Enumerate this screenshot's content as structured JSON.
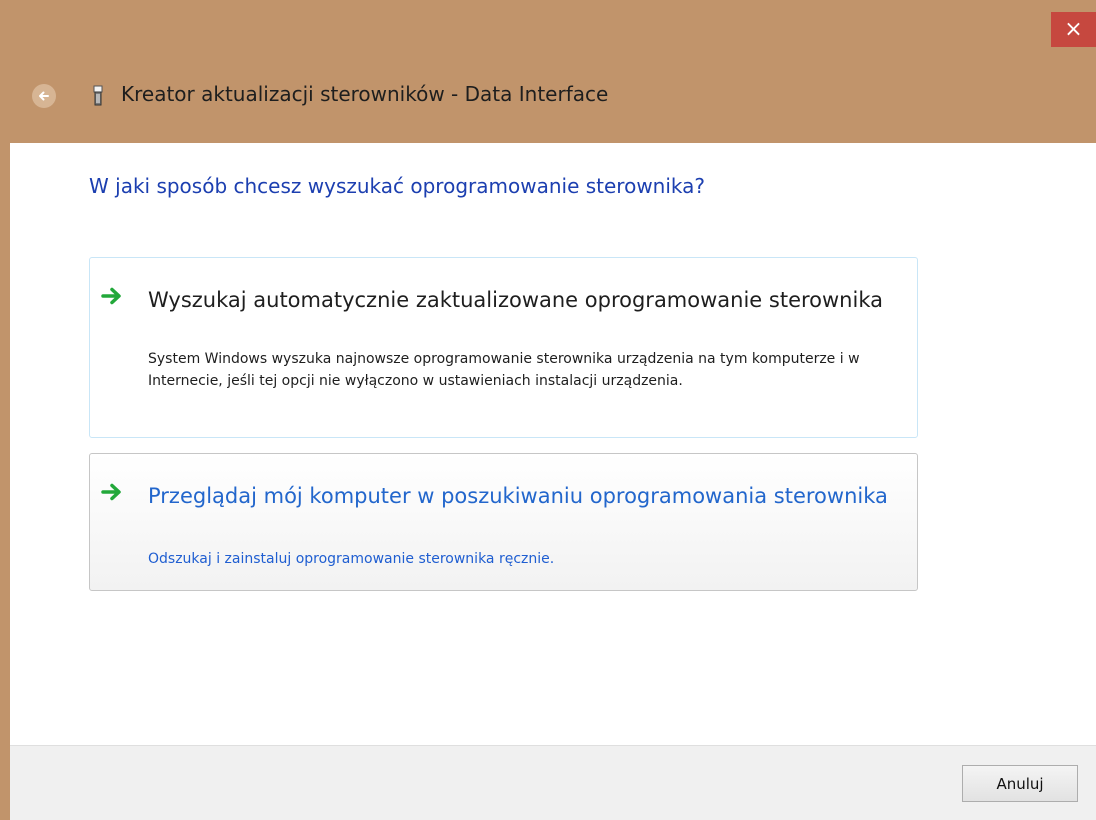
{
  "window": {
    "title": "Kreator aktualizacji sterowników - Data Interface",
    "close_symbol": "×",
    "accent_color": "#c1946b",
    "close_color": "#c6483f"
  },
  "header": {
    "back_icon": "back-arrow-icon",
    "device_icon": "usb-device-icon"
  },
  "main": {
    "question": "W jaki sposób chcesz wyszukać oprogramowanie sterownika?",
    "options": [
      {
        "icon": "green-arrow-icon",
        "title": "Wyszukaj automatycznie zaktualizowane oprogramowanie sterownika",
        "description": "System Windows wyszuka najnowsze oprogramowanie sterownika urządzenia na tym komputerze i w Internecie, jeśli tej opcji nie wyłączono w ustawieniach instalacji urządzenia."
      },
      {
        "icon": "green-arrow-icon",
        "title": "Przeglądaj mój komputer w poszukiwaniu oprogramowania sterownika",
        "description": "Odszukaj i zainstaluj oprogramowanie sterownika ręcznie."
      }
    ]
  },
  "footer": {
    "cancel_label": "Anuluj"
  }
}
